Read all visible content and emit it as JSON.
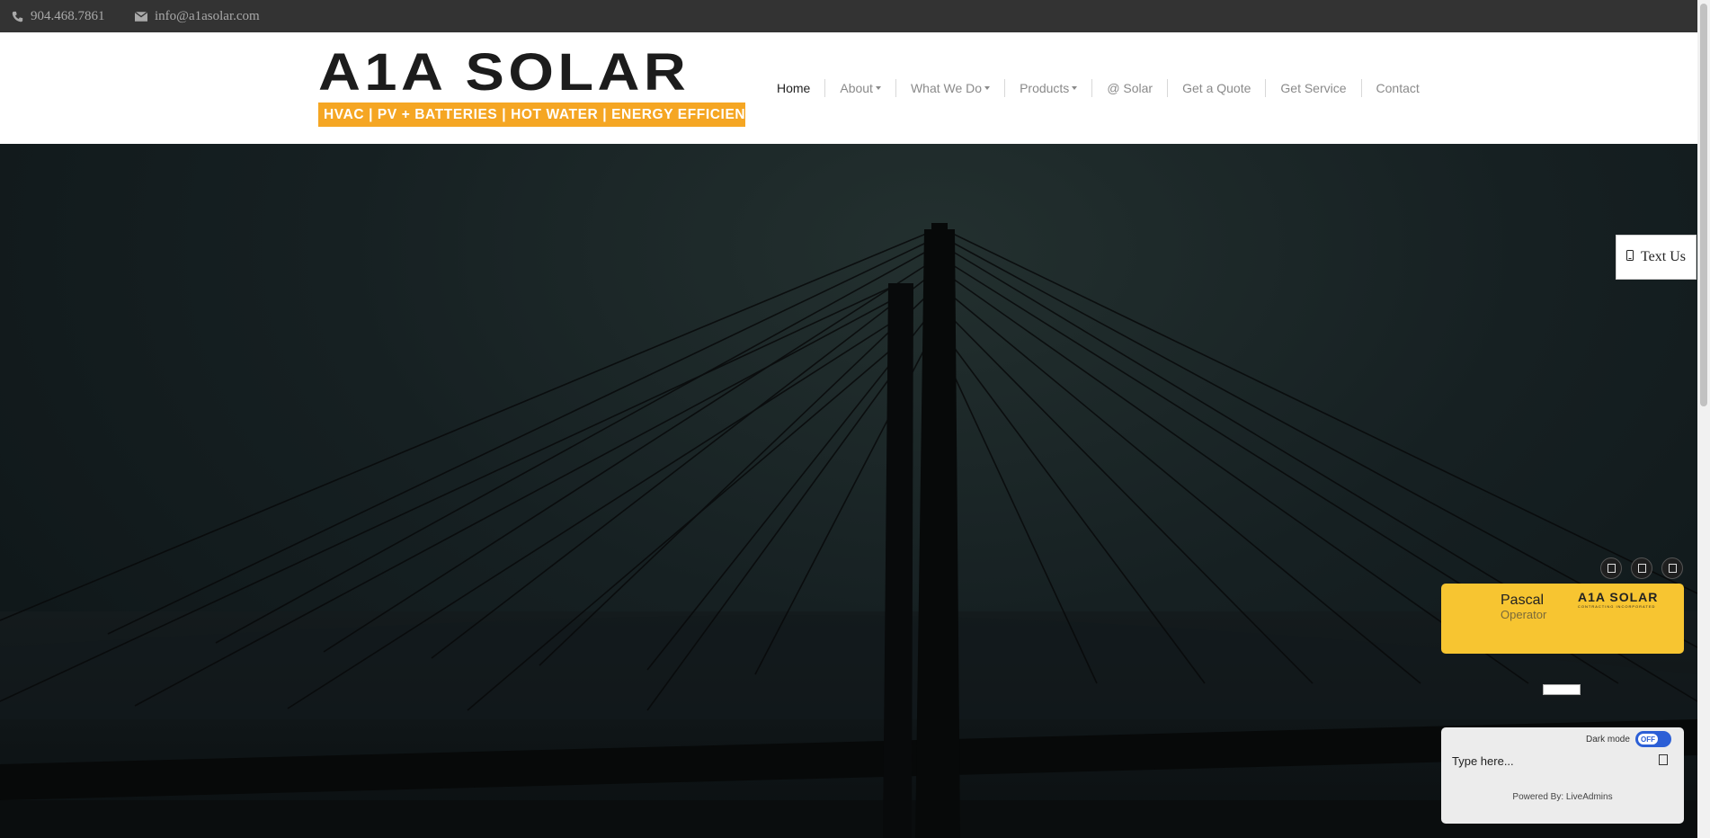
{
  "topbar": {
    "phone": "904.468.7861",
    "email": "info@a1asolar.com"
  },
  "logo": {
    "name": "A1A SOLAR",
    "tagline": "HVAC | PV + BATTERIES | HOT WATER | ENERGY EFFICIENCY"
  },
  "nav": [
    {
      "label": "Home",
      "active": true,
      "dropdown": false
    },
    {
      "label": "About",
      "dropdown": true
    },
    {
      "label": "What We Do",
      "dropdown": true
    },
    {
      "label": "Products",
      "dropdown": true
    },
    {
      "label": "@ Solar",
      "dropdown": false
    },
    {
      "label": "Get a Quote",
      "dropdown": false
    },
    {
      "label": "Get Service",
      "dropdown": false
    },
    {
      "label": "Contact",
      "dropdown": false
    }
  ],
  "text_us": {
    "label": "Text Us",
    "icon": "mobile-phone-icon"
  },
  "chat": {
    "operator_name": "Pascal",
    "operator_role": "Operator",
    "brand_logo": "A1A SOLAR",
    "brand_sub": "CONTRACTING INCORPORATED",
    "dark_mode_label": "Dark mode",
    "dark_mode_state": "OFF",
    "input_placeholder": "Type here...",
    "powered_by": "Powered By: LiveAdmins"
  },
  "colors": {
    "accent": "#f5a623",
    "topbar": "#333333",
    "chat_header": "#f7c531",
    "toggle": "#2c5fd6"
  }
}
